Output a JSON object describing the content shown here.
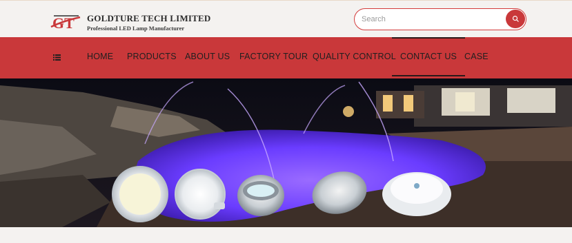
{
  "brand": {
    "mark": "GT",
    "name": "GOLDTURE TECH LIMITED",
    "tagline": "Professional LED Lamp Manufacturer"
  },
  "search": {
    "placeholder": "Search",
    "icon": "search-icon"
  },
  "nav": {
    "menu_icon": "list-icon",
    "items": [
      {
        "label": "HOME"
      },
      {
        "label": "PRODUCTS"
      },
      {
        "label": "ABOUT US"
      },
      {
        "label": "FACTORY TOUR"
      },
      {
        "label": "QUALITY CONTROL"
      },
      {
        "label": "CONTACT US",
        "active": true
      },
      {
        "label": "CASE"
      }
    ]
  },
  "colors": {
    "accent": "#c9383a",
    "pool": "#6a3cff",
    "background": "#f4f2f0"
  }
}
